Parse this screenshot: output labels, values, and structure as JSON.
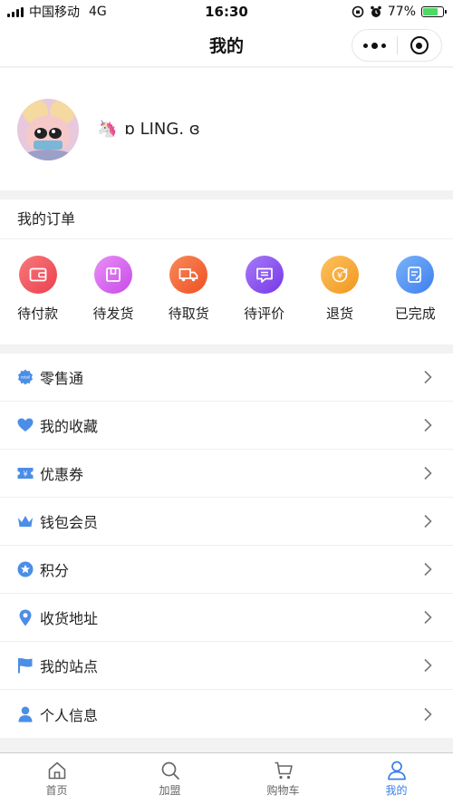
{
  "status_bar": {
    "carrier": "中国移动",
    "network": "4G",
    "time": "16:30",
    "battery": "77%",
    "battery_level": 0.77
  },
  "nav": {
    "title": "我的"
  },
  "profile": {
    "emoji": "🦄",
    "nickname": "ɒ LING. ɞ"
  },
  "orders": {
    "title": "我的订单",
    "items": [
      {
        "label": "待付款",
        "icon": "wallet-icon",
        "color": "#f0505a"
      },
      {
        "label": "待发货",
        "icon": "package-icon",
        "color": "#d85ff0"
      },
      {
        "label": "待取货",
        "icon": "truck-icon",
        "color": "#f2663a"
      },
      {
        "label": "待评价",
        "icon": "comment-icon",
        "color": "#8a4ff0"
      },
      {
        "label": "退货",
        "icon": "refund-icon",
        "color": "#f7a431"
      },
      {
        "label": "已完成",
        "icon": "done-icon",
        "color": "#4f8ff3"
      }
    ]
  },
  "menu": {
    "items": [
      {
        "label": "零售通",
        "icon": "retail-icon"
      },
      {
        "label": "我的收藏",
        "icon": "heart-icon"
      },
      {
        "label": "优惠券",
        "icon": "coupon-icon"
      },
      {
        "label": "钱包会员",
        "icon": "crown-icon"
      },
      {
        "label": "积分",
        "icon": "star-icon"
      },
      {
        "label": "收货地址",
        "icon": "location-icon"
      },
      {
        "label": "我的站点",
        "icon": "flag-icon"
      },
      {
        "label": "个人信息",
        "icon": "person-icon"
      }
    ]
  },
  "tab_bar": {
    "items": [
      {
        "label": "首页",
        "icon": "home-icon"
      },
      {
        "label": "加盟",
        "icon": "search-icon"
      },
      {
        "label": "购物车",
        "icon": "cart-icon"
      },
      {
        "label": "我的",
        "icon": "user-icon",
        "active": true
      }
    ]
  },
  "colors": {
    "accent": "#3b7de8",
    "menu_icon": "#4a8ee8"
  }
}
